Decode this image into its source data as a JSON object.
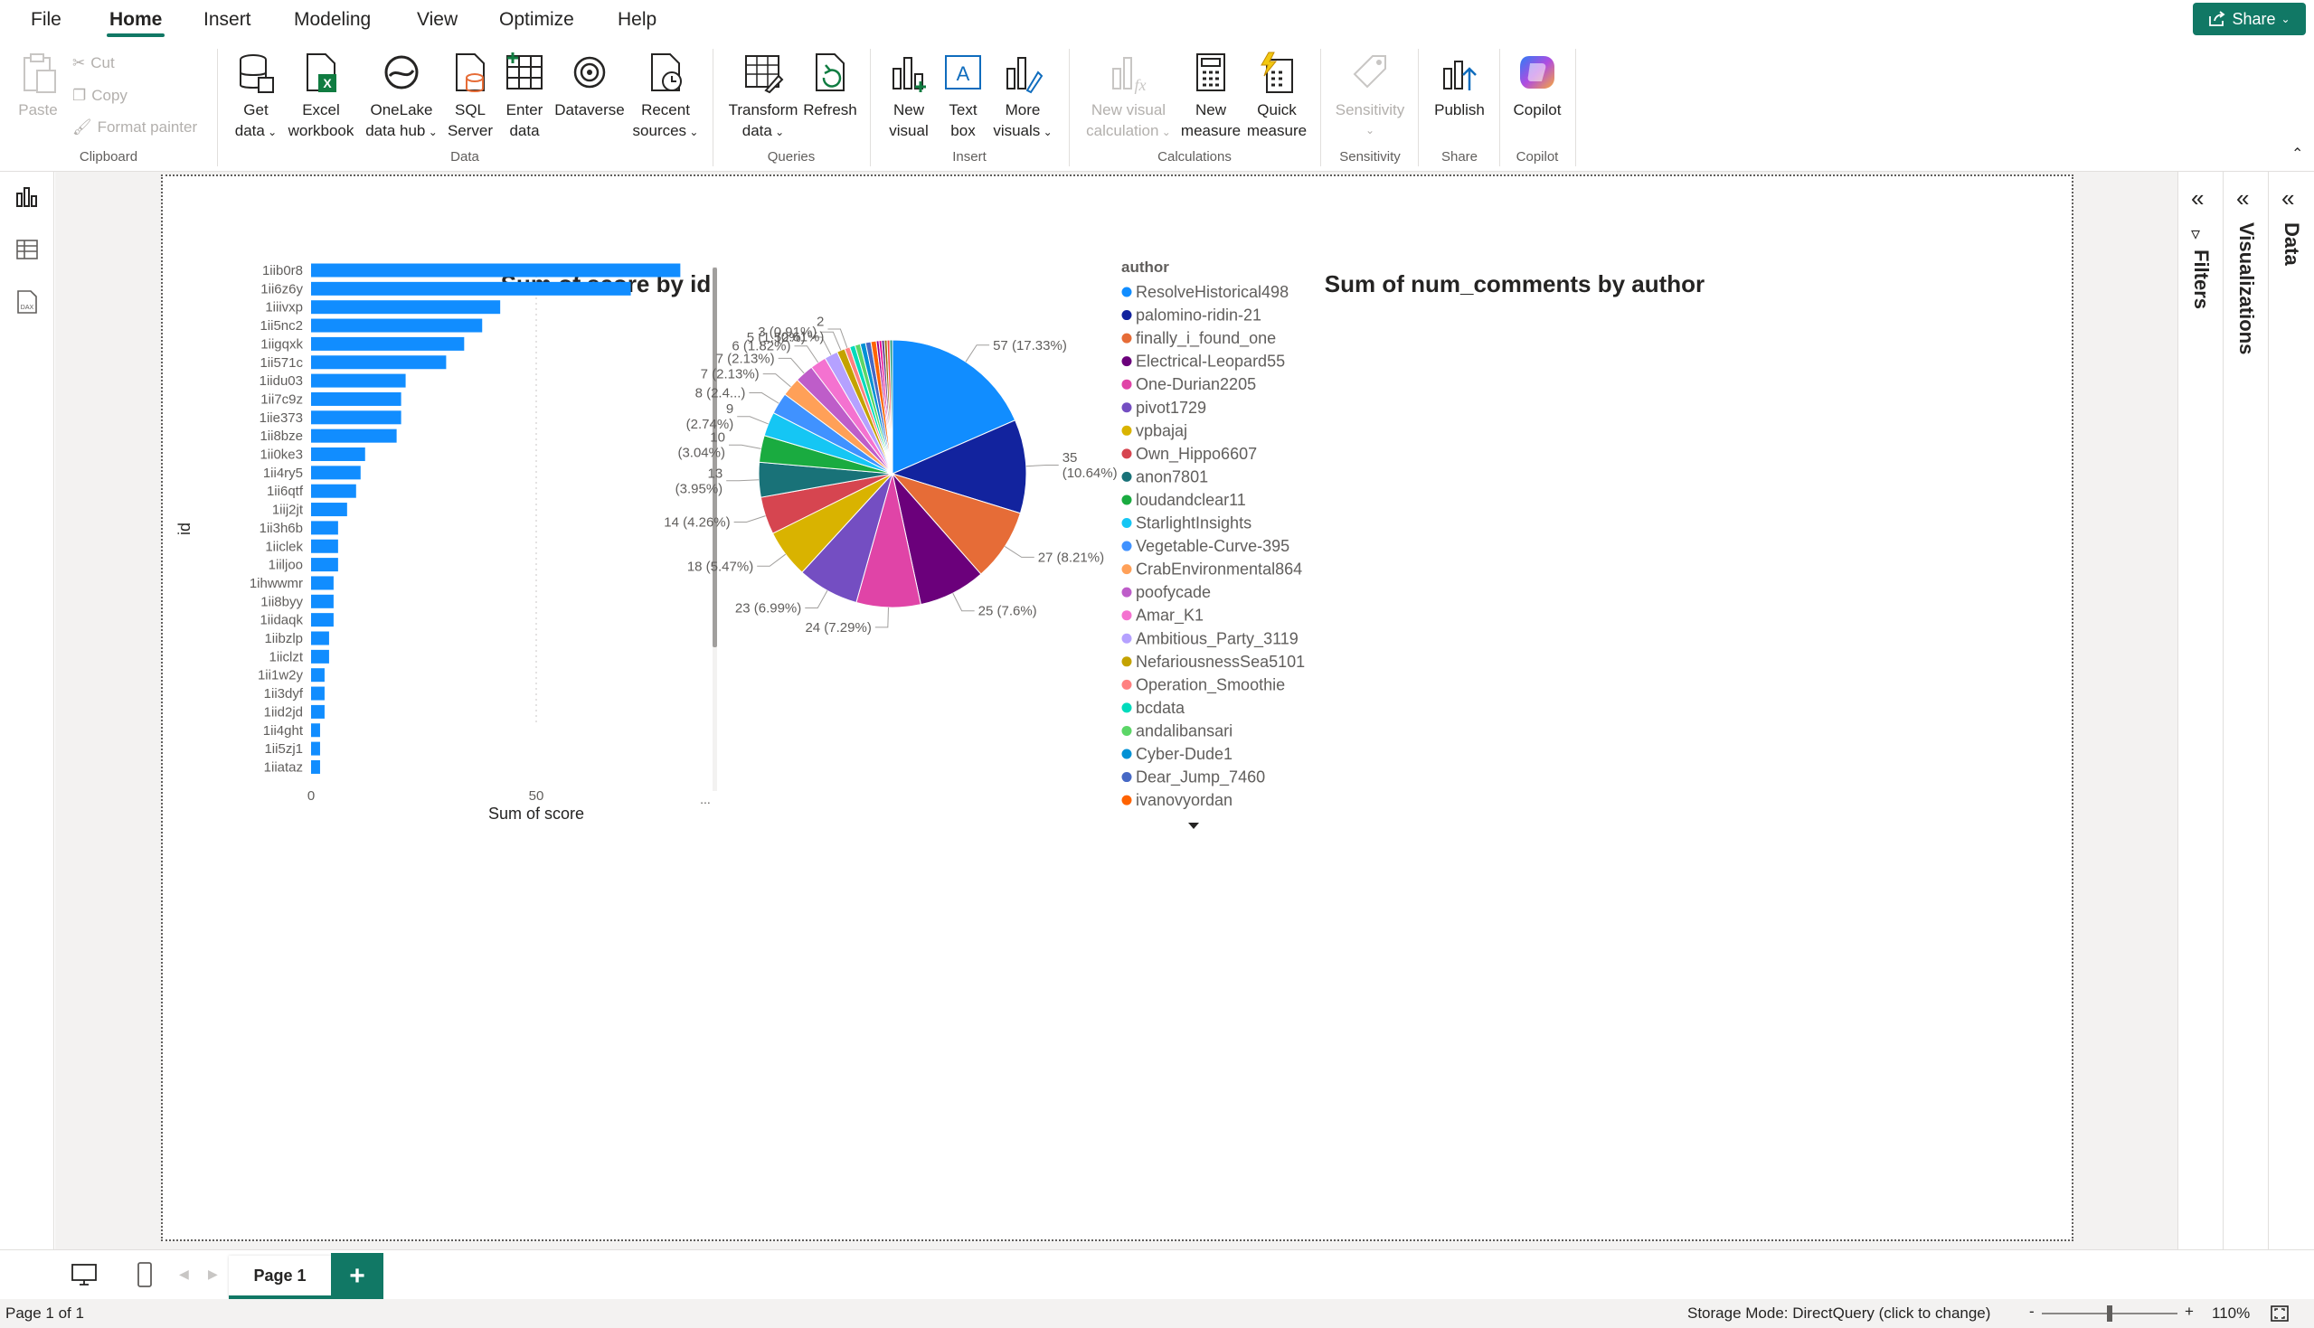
{
  "menu": {
    "items": [
      "File",
      "Home",
      "Insert",
      "Modeling",
      "View",
      "Optimize",
      "Help"
    ],
    "active": "Home",
    "share_label": "Share"
  },
  "ribbon": {
    "clipboard": {
      "paste": "Paste",
      "cut": "Cut",
      "copy": "Copy",
      "format_painter": "Format painter",
      "caption": "Clipboard"
    },
    "data": {
      "get_data": [
        "Get",
        "data"
      ],
      "excel": [
        "Excel",
        "workbook"
      ],
      "onelake": [
        "OneLake",
        "data hub"
      ],
      "sql": [
        "SQL",
        "Server"
      ],
      "enter": [
        "Enter",
        "data"
      ],
      "dataverse": "Dataverse",
      "recent": [
        "Recent",
        "sources"
      ],
      "caption": "Data"
    },
    "queries": {
      "transform": [
        "Transform",
        "data"
      ],
      "refresh": "Refresh",
      "caption": "Queries"
    },
    "insert": {
      "new_visual": [
        "New",
        "visual"
      ],
      "text_box": [
        "Text",
        "box"
      ],
      "more_visuals": [
        "More",
        "visuals"
      ],
      "caption": "Insert"
    },
    "calculations": {
      "new_visual_calc": [
        "New visual",
        "calculation"
      ],
      "new_measure": [
        "New",
        "measure"
      ],
      "quick_measure": [
        "Quick",
        "measure"
      ],
      "caption": "Calculations"
    },
    "sensitivity": {
      "label": "Sensitivity",
      "caption": "Sensitivity"
    },
    "share": {
      "publish": "Publish",
      "caption": "Share"
    },
    "copilot": {
      "label": "Copilot",
      "caption": "Copilot"
    }
  },
  "panes": {
    "filters": "Filters",
    "visualizations": "Visualizations",
    "data": "Data"
  },
  "tabs": {
    "page1": "Page 1",
    "add": "+"
  },
  "status": {
    "page": "Page 1 of 1",
    "storage": "Storage Mode: DirectQuery (click to change)",
    "zoom": "110%",
    "minus": "-",
    "plus": "+"
  },
  "colors": {
    "accent": "#117865",
    "bar": "#118dff"
  },
  "chart_data": [
    {
      "type": "bar",
      "orientation": "horizontal",
      "title": "Sum of score by id",
      "xlabel": "Sum of score",
      "ylabel": "id",
      "xticks": [
        "0",
        "50"
      ],
      "more_indicator": "...",
      "categories": [
        "1iib0r8",
        "1ii6z6y",
        "1iiivxp",
        "1ii5nc2",
        "1iigqxk",
        "1ii571c",
        "1iidu03",
        "1ii7c9z",
        "1iie373",
        "1ii8bze",
        "1ii0ke3",
        "1ii4ry5",
        "1ii6qtf",
        "1iij2jt",
        "1ii3h6b",
        "1iiclek",
        "1iiljoo",
        "1ihwwmr",
        "1ii8byy",
        "1iidaqk",
        "1iibzlp",
        "1iiclzt",
        "1ii1w2y",
        "1ii3dyf",
        "1iid2jd",
        "1ii4ght",
        "1ii5zj1",
        "1iiataz"
      ],
      "values": [
        82,
        71,
        42,
        38,
        34,
        30,
        21,
        20,
        20,
        19,
        12,
        11,
        10,
        8,
        6,
        6,
        6,
        5,
        5,
        5,
        4,
        4,
        3,
        3,
        3,
        2,
        2,
        2
      ],
      "xlim": [
        0,
        100
      ]
    },
    {
      "type": "pie",
      "title": "Sum of num_comments by author",
      "legend_title": "author",
      "legend": [
        "ResolveHistorical498",
        "palomino-ridin-21",
        "finally_i_found_one",
        "Electrical-Leopard55",
        "One-Durian2205",
        "pivot1729",
        "vpbajaj",
        "Own_Hippo6607",
        "anon7801",
        "loudandclear11",
        "StarlightInsights",
        "Vegetable-Curve-395",
        "CrabEnvironmental864",
        "poofycade",
        "Amar_K1",
        "Ambitious_Party_3119",
        "NefariousnessSea5101",
        "Operation_Smoothie",
        "bcdata",
        "andalibansari",
        "Cyber-Dude1",
        "Dear_Jump_7460",
        "ivanovyordan"
      ],
      "values": [
        57,
        35,
        27,
        25,
        24,
        23,
        18,
        14,
        13,
        10,
        9,
        8,
        7,
        7,
        6,
        5,
        3,
        2,
        2,
        2,
        2,
        2,
        2,
        1,
        1,
        1,
        1,
        1,
        1
      ],
      "colors": [
        "#118dff",
        "#12239e",
        "#e66c37",
        "#6b007b",
        "#e044a7",
        "#744ec2",
        "#d9b300",
        "#d64550",
        "#197278",
        "#1aab40",
        "#15c6f4",
        "#4092ff",
        "#ffa058",
        "#be5dc9",
        "#f472d0",
        "#b5a1ff",
        "#c4a200",
        "#ff8080",
        "#00dbbc",
        "#5bd667",
        "#0091d5",
        "#4668c5",
        "#ff6300",
        "#99008a",
        "#ec008c",
        "#533285",
        "#99700a",
        "#ff4141",
        "#1f9a85"
      ],
      "data_labels": [
        {
          "idx": 0,
          "lines": [
            "57 (17.33%)"
          ]
        },
        {
          "idx": 1,
          "lines": [
            "35",
            "(10.64%)"
          ]
        },
        {
          "idx": 2,
          "lines": [
            "27 (8.21%)"
          ]
        },
        {
          "idx": 3,
          "lines": [
            "25 (7.6%)"
          ]
        },
        {
          "idx": 4,
          "lines": [
            "24 (7.29%)"
          ]
        },
        {
          "idx": 5,
          "lines": [
            "23 (6.99%)"
          ]
        },
        {
          "idx": 6,
          "lines": [
            "18 (5.47%)"
          ]
        },
        {
          "idx": 7,
          "lines": [
            "14 (4.26%)"
          ]
        },
        {
          "idx": 8,
          "lines": [
            "13",
            "(3.95%)"
          ]
        },
        {
          "idx": 9,
          "lines": [
            "10",
            "(3.04%)"
          ]
        },
        {
          "idx": 10,
          "lines": [
            "9",
            "(2.74%)"
          ]
        },
        {
          "idx": 11,
          "lines": [
            "8 (2.4...)"
          ]
        },
        {
          "idx": 12,
          "lines": [
            "7 (2.13%)"
          ]
        },
        {
          "idx": 13,
          "lines": [
            "7 (2.13%)"
          ]
        },
        {
          "idx": 14,
          "lines": [
            "6 (1.82%)"
          ]
        },
        {
          "idx": 15,
          "lines": [
            "5 (1.52%)"
          ]
        },
        {
          "idx": 16,
          "lines": [
            "3 (0.91%)"
          ]
        },
        {
          "idx": 17,
          "lines": [
            "2",
            "(0.61%)"
          ]
        }
      ]
    }
  ]
}
